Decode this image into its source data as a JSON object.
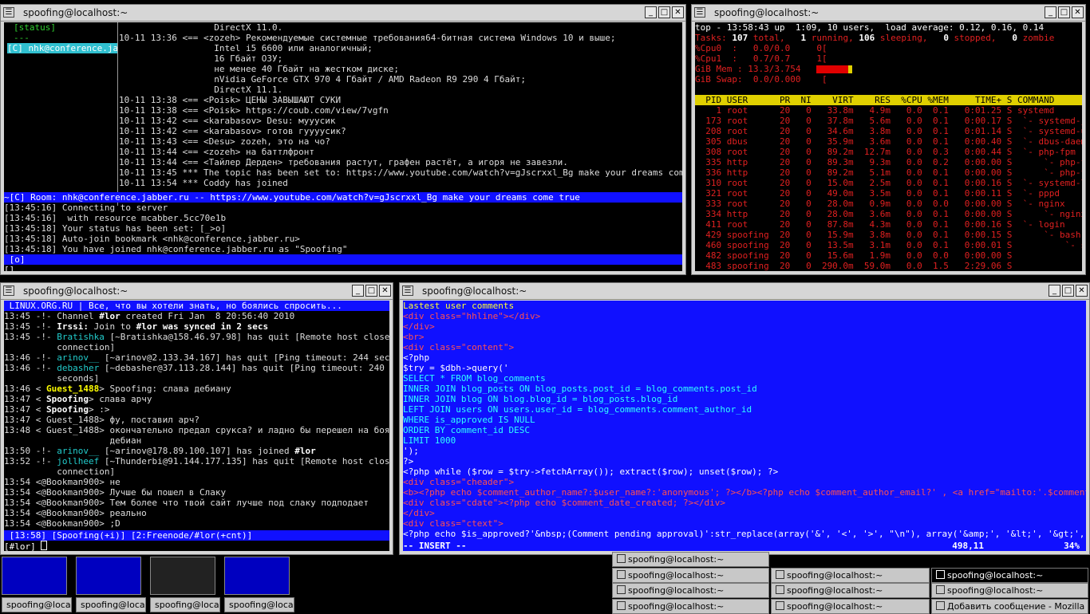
{
  "windows": {
    "title": "spoofing@localhost:~",
    "menu_glyph": "☰",
    "min_glyph": "_",
    "max_glyph": "□",
    "close_glyph": "✕"
  },
  "mcabber": {
    "roster": [
      "[status]",
      "---",
      "[C] nhk@conference.ja"
    ],
    "chat": [
      "                  DirectX 11.0.",
      "10-11 13:36 <== <zozeh> Рекомендуемые системные требования64-битная система Windows 10 и выше;",
      "                  Intel i5 6600 или аналогичный;",
      "                  16 Гбайт ОЗУ;",
      "                  не менее 40 Гбайт на жестком диске;",
      "                  nVidia GeForce GTX 970 4 Гбайт / AMD Radeon R9 290 4 Гбайт;",
      "                  DirectX 11.1.",
      "10-11 13:38 <== <Poisk> ЦЕНЫ ЗАВЫШАЮТ СУКИ",
      "10-11 13:38 <== <Poisk> https://coub.com/view/7vgfn",
      "10-11 13:42 <== <karabasov> Desu: мууусик",
      "10-11 13:42 <== <karabasov> готов гуууусик?",
      "10-11 13:43 <== <Desu> zozeh, это на чо?",
      "10-11 13:44 <== <zozeh> на баттлфронт",
      "10-11 13:44 <== <Тайлер Дерден> требования растут, графен растёт, а игоря не завезли.",
      "10-11 13:45 *** The topic has been set to: https://www.youtube.com/watch?v=gJscrxxl_Bg make your dreams come true",
      "10-11 13:54 *** Coddy has joined"
    ],
    "room_bar": "~[C] Room: nhk@conference.jabber.ru -- https://www.youtube.com/watch?v=gJscrxxl_Bg make your dreams come true",
    "log": [
      "[13:45:16] Connecting to server",
      "[13:45:16]  with resource mcabber.5cc70e1b",
      "[13:45:18] Your status has been set: [_>o]",
      "[13:45:18] Auto-join bookmark <nhk@conference.jabber.ru>",
      "[13:45:18] You have joined nhk@conference.jabber.ru as \"Spoofing\""
    ],
    "status_bar": " [o]",
    "prompt": "[]"
  },
  "top": {
    "line1": "top - 13:58:43 up  1:09, 10 users,  load average: 0.12, 0.16, 0.14",
    "tasks_label": "Tasks:",
    "tasks": {
      "total": "107",
      "running": "1",
      "sleeping": "106",
      "stopped": "0",
      "zombie": "0"
    },
    "cpu0": "%Cpu0  :   0.0/0.0     0[",
    "cpu1": "%Cpu1  :   0.7/0.7     1[",
    "mem": "GiB Mem : 13.3/3.754    [",
    "swap": "GiB Swap:  0.0/0.000    [",
    "header": "  PID USER      PR  NI    VIRT    RES  %CPU %MEM     TIME+ S COMMAND",
    "processes": [
      "    1 root      20   0   33.8m   4.9m   0.0  0.1   0:01.25 S systemd",
      "  173 root      20   0   37.8m   5.6m   0.0  0.1   0:00.17 S  `- systemd-journ+",
      "  208 root      20   0   34.6m   3.8m   0.0  0.1   0:01.14 S  `- systemd-udevd",
      "  305 dbus      20   0   35.9m   3.6m   0.0  0.1   0:00.40 S  `- dbus-daemon",
      "  308 root      20   0   89.2m  12.7m   0.0  0.3   0:00.44 S  `- php-fpm",
      "  335 http      20   0   89.3m   9.3m   0.0  0.2   0:00.00 S      `- php-fpm",
      "  336 http      20   0   89.2m   5.1m   0.0  0.1   0:00.00 S      `- php-fpm",
      "  310 root      20   0   15.0m   2.5m   0.0  0.1   0:00.16 S  `- systemd-logind",
      "  321 root      20   0   49.0m   3.5m   0.0  0.1   0:00.11 S  `- pppd",
      "  333 root      20   0   28.0m   0.9m   0.0  0.0   0:00.00 S  `- nginx",
      "  334 http      20   0   28.0m   3.6m   0.0  0.1   0:00.00 S      `- nginx",
      "  411 root      20   0   87.8m   4.3m   0.0  0.1   0:00.16 S  `- login",
      "  429 spoofing  20   0   15.9m   3.8m   0.0  0.1   0:00.15 S      `- bash",
      "  460 spoofing  20   0   13.5m   3.1m   0.0  0.1   0:00.01 S          `- startx",
      "  482 spoofing  20   0   15.6m   1.9m   0.0  0.0   0:00.00 S              `- x+",
      "  483 spoofing  20   0  290.0m  59.0m   0.0  1.5   2:29.06 S                  `+"
    ],
    "mem_fraction": 0.8,
    "colors": {
      "bar": "#e00000",
      "header": "#e0d000"
    }
  },
  "irssi": {
    "topic": " LINUX.ORG.RU | Все, что вы хотели знать, но боялись спросить...",
    "lines": [
      [
        "13:45 -!- Channel ",
        "#lor",
        " created Fri Jan  8 20:56:40 2010",
        ""
      ],
      [
        "13:45 -!- ",
        "Irssi:",
        " Join to ",
        "#lor was synced in 2 secs"
      ],
      [
        "13:45 -!- ",
        "Bratishka",
        " [~Bratishka@158.46.97.98] has quit [Remote host closed the",
        ""
      ],
      [
        "          connection]",
        "",
        "",
        ""
      ],
      [
        "13:46 -!- ",
        "arinov__",
        " [~arinov@2.133.34.167] has quit [Ping timeout: 244 seconds]",
        ""
      ],
      [
        "13:46 -!- ",
        "debasher",
        " [~debasher@37.113.28.144] has quit [Ping timeout: 240",
        ""
      ],
      [
        "          seconds]",
        "",
        "",
        ""
      ],
      [
        "13:46 < ",
        "Guest_1488",
        "> Spoofing: слава дебиану",
        ""
      ],
      [
        "13:47 < ",
        "Spoofing",
        "> слава арчу",
        ""
      ],
      [
        "13:47 < ",
        "Spoofing",
        "> :>",
        ""
      ],
      [
        "13:47 < Guest_1488> фу, поставил арч?",
        "",
        "",
        ""
      ],
      [
        "13:48 < Guest_1488> окончательно предал срукса? и ладно бы перешел на боярский",
        "",
        "",
        ""
      ],
      [
        "                    дебиан",
        "",
        "",
        ""
      ],
      [
        "13:50 -!- ",
        "arinov__",
        " [~arinov@178.89.100.107] has joined ",
        "#lor"
      ],
      [
        "13:52 -!- ",
        "jollheef",
        " [~Thunderbi@91.144.177.135] has quit [Remote host closed the",
        ""
      ],
      [
        "          connection]",
        "",
        "",
        ""
      ],
      [
        "13:54 <@Bookman900> не",
        "",
        "",
        ""
      ],
      [
        "13:54 <@Bookman900> Лучше бы пошел в Слаку",
        "",
        "",
        ""
      ],
      [
        "13:54 <@Bookman900> Тем более что твой сайт лучше под слаку подподает",
        "",
        "",
        ""
      ],
      [
        "13:54 <@Bookman900> реально",
        "",
        "",
        ""
      ],
      [
        "13:54 <@Bookman900> ;D",
        "",
        "",
        ""
      ]
    ],
    "status": " [13:58] [Spoofing(+i)] [2:Freenode/#lor(+cnt)]",
    "input": "[#lor] "
  },
  "vim": {
    "lines": [
      "Lastest user comments",
      "<div class=\"hhline\"></div>",
      "</div>",
      "<br>",
      "<div class=\"content\">",
      "<?php",
      "$try = $dbh->query('",
      "SELECT * FROM blog_comments",
      "INNER JOIN blog_posts ON blog_posts.post_id = blog_comments.post_id",
      "INNER JOIN blog ON blog.blog_id = blog_posts.blog_id",
      "LEFT JOIN users ON users.user_id = blog_comments.comment_author_id",
      "WHERE is_approved IS NULL",
      "ORDER BY comment_id DESC",
      "LIMIT 1000",
      "');",
      "?>",
      "<?php while ($row = $try->fetchArray()); extract($row); unset($row); ?>",
      "<div class=\"cheader\">",
      "<b><?php echo $comment_author_name?:$user_name?:'anonymous'; ?></b><?php echo $comment_author_email?' , <a href=\"mailto:'.$comment_author_ema",
      "<div class=\"cdate\"><?php echo $comment_date_created; ?></div>",
      "</div>",
      "<div class=\"ctext\">",
      "<?php echo $is_approved?'&nbsp;(Comment pending approval)':str_replace(array('&', '<', '>', \"\\n\"), array('&amp;', '&lt;', '&gt;', \"<br>\\n\"),"
    ],
    "mode": "-- INSERT --",
    "position": "498,11",
    "percent": "34%"
  },
  "taskbar": {
    "left": [
      "spoofing@local",
      "spoofing@local",
      "spoofing@local",
      "spoofing@local"
    ],
    "right": [
      [
        "spoofing@localhost:~",
        "",
        ""
      ],
      [
        "spoofing@localhost:~",
        "spoofing@localhost:~",
        "spoofing@localhost:~"
      ],
      [
        "spoofing@localhost:~",
        "spoofing@localhost:~",
        "spoofing@localhost:~"
      ],
      [
        "spoofing@localhost:~",
        "spoofing@localhost:~",
        "Добавить сообщение - Mozilla F"
      ]
    ]
  }
}
